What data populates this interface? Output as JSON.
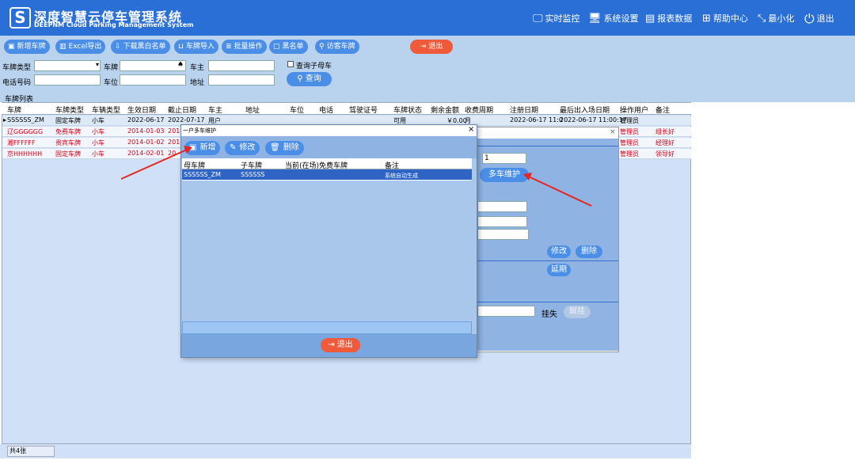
{
  "header": {
    "logo_letter": "S",
    "title": "深度智慧云停车管理系统",
    "subtitle": "DEEPNM Cloud Parking Management System",
    "nav": [
      {
        "label": "实时监控",
        "icon": "monitor-icon"
      },
      {
        "label": "系统设置",
        "icon": "settings-screen-icon"
      },
      {
        "label": "报表数据",
        "icon": "report-icon"
      },
      {
        "label": "帮助中心",
        "icon": "grid-help-icon"
      },
      {
        "label": "最小化",
        "icon": "minimize-icon"
      },
      {
        "label": "退出",
        "icon": "power-icon"
      }
    ]
  },
  "toolbar": {
    "buttons": [
      "新增车牌",
      "Excel导出",
      "下载黑白名单",
      "车牌导入",
      "批量操作",
      "黑名单",
      "访客车牌"
    ],
    "exit_label": "退出"
  },
  "search": {
    "plate_type_label": "车牌类型",
    "plate_label": "车牌",
    "owner_label": "车主",
    "sub_car_checkbox_label": "查询子母车",
    "phone_label": "电话号码",
    "space_label": "车位",
    "address_label": "地址",
    "query_button": "查询"
  },
  "list": {
    "caption": "车牌列表",
    "columns": [
      "车牌",
      "车牌类型",
      "车辆类型",
      "生效日期",
      "截止日期",
      "车主",
      "地址",
      "车位",
      "电话",
      "驾驶证号",
      "车牌状态",
      "剩余金额",
      "收费周期",
      "注册日期",
      "最后出入场日期",
      "操作用户",
      "备注"
    ],
    "rows": [
      {
        "plate": "SSSSSS_ZM",
        "plate_type": "固定车牌",
        "vehicle_type": "小车",
        "start": "2022-06-17",
        "end": "2022-07-17",
        "owner": "用户",
        "status": "可用",
        "balance": "￥0.00",
        "cycle": "月",
        "reg": "2022-06-17 11:0",
        "last": "2022-06-17 11:00:17",
        "user": "管理员",
        "note": "",
        "color": "#000000"
      },
      {
        "plate": "辽GGGGGG",
        "plate_type": "免费车牌",
        "vehicle_type": "小车",
        "start": "2014-01-03",
        "end": "2018",
        "owner": "",
        "status": "",
        "balance": "",
        "cycle": "",
        "reg": "",
        "last": "",
        "user": "管理员",
        "note": "组长好",
        "color": "#d0021b"
      },
      {
        "plate": "湘FFFFFF",
        "plate_type": "贵宾车牌",
        "vehicle_type": "小车",
        "start": "2014-01-02",
        "end": "2016",
        "owner": "",
        "status": "",
        "balance": "",
        "cycle": "",
        "reg": "",
        "last": "",
        "user": "管理员",
        "note": "经理好",
        "color": "#d0021b"
      },
      {
        "plate": "京HHHHHH",
        "plate_type": "固定车牌",
        "vehicle_type": "小车",
        "start": "2014-02-01",
        "end": "20",
        "owner": "",
        "status": "",
        "balance": "",
        "cycle": "",
        "reg": "",
        "last": "",
        "user": "管理员",
        "note": "领导好",
        "color": "#d0021b"
      }
    ],
    "total": "共4张"
  },
  "dialog_back": {
    "field_value": "1",
    "multi_car_button": "多车维护",
    "modify_button": "修改",
    "delete_button": "删除",
    "extend_button": "延期",
    "lost_label": "挂失",
    "unlost_button": "解挂"
  },
  "dialog_front": {
    "title": "一户多车维护",
    "add_button": "新增",
    "modify_button": "修改",
    "delete_button": "删除",
    "columns": [
      "母车牌",
      "子车牌",
      "当前(在场)免费车牌",
      "备注"
    ],
    "rows": [
      {
        "parent": "SSSSSS_ZM",
        "child": "SSSSSS",
        "free": "",
        "note": "系统自动生成"
      }
    ],
    "exit_button": "退出"
  },
  "colors": {
    "header_bg": "#2a6fd6",
    "button_blue": "#4a8ee8",
    "button_red": "#ef5a3a",
    "selected_row": "#2f63c4",
    "arrow_red": "#e8251e"
  }
}
